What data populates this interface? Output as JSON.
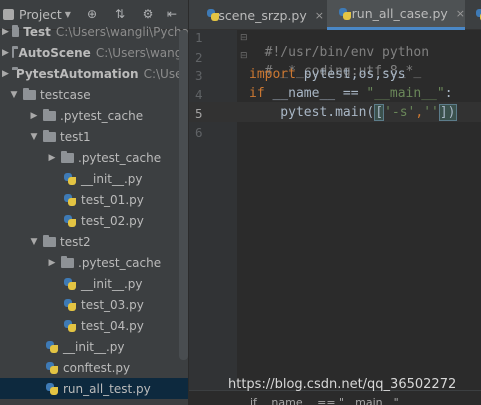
{
  "project_panel": {
    "title": "Project",
    "tree": [
      {
        "label": "Test",
        "path": "C:\\Users\\wangli\\Pycha",
        "bold": true
      },
      {
        "label": "AutoScene",
        "path": "C:\\Users\\wangli",
        "bold": true
      },
      {
        "label": "PytestAutomation",
        "path": "C:\\Users",
        "bold": true
      },
      {
        "label": "testcase"
      },
      {
        "label": ".pytest_cache"
      },
      {
        "label": "test1"
      },
      {
        "label": ".pytest_cache"
      },
      {
        "label": "__init__.py"
      },
      {
        "label": "test_01.py"
      },
      {
        "label": "test_02.py"
      },
      {
        "label": "test2"
      },
      {
        "label": ".pytest_cache"
      },
      {
        "label": "__init__.py"
      },
      {
        "label": "test_03.py"
      },
      {
        "label": "test_04.py"
      },
      {
        "label": "__init__.py"
      },
      {
        "label": "conftest.py"
      },
      {
        "label": "run_all_test.py"
      }
    ]
  },
  "tabs": [
    {
      "label": "scene_srzp.py"
    },
    {
      "label": "run_all_case.py"
    }
  ],
  "editor": {
    "line_numbers": [
      "1",
      "2",
      "3",
      "4",
      "5",
      "6"
    ],
    "lines": {
      "l1": "#!/usr/bin/env python",
      "l2": "# _*_coding:utf-8_*_",
      "l3_kw": "import",
      "l3_rest": " pytest,os,sys",
      "l4_kw": "if",
      "l4_mid": " __name__ == ",
      "l4_str": "\"__main__\"",
      "l4_end": ":",
      "l5_pre": "    pytest.main(",
      "l5_bracket_open": "[",
      "l5_str1": "'-s'",
      "l5_comma": ",",
      "l5_str2": "''",
      "l5_bracket_close": "])"
    },
    "breadcrumb": "if __name__ == \"__main__\""
  },
  "watermark": "https://blog.csdn.net/qq_36502272"
}
